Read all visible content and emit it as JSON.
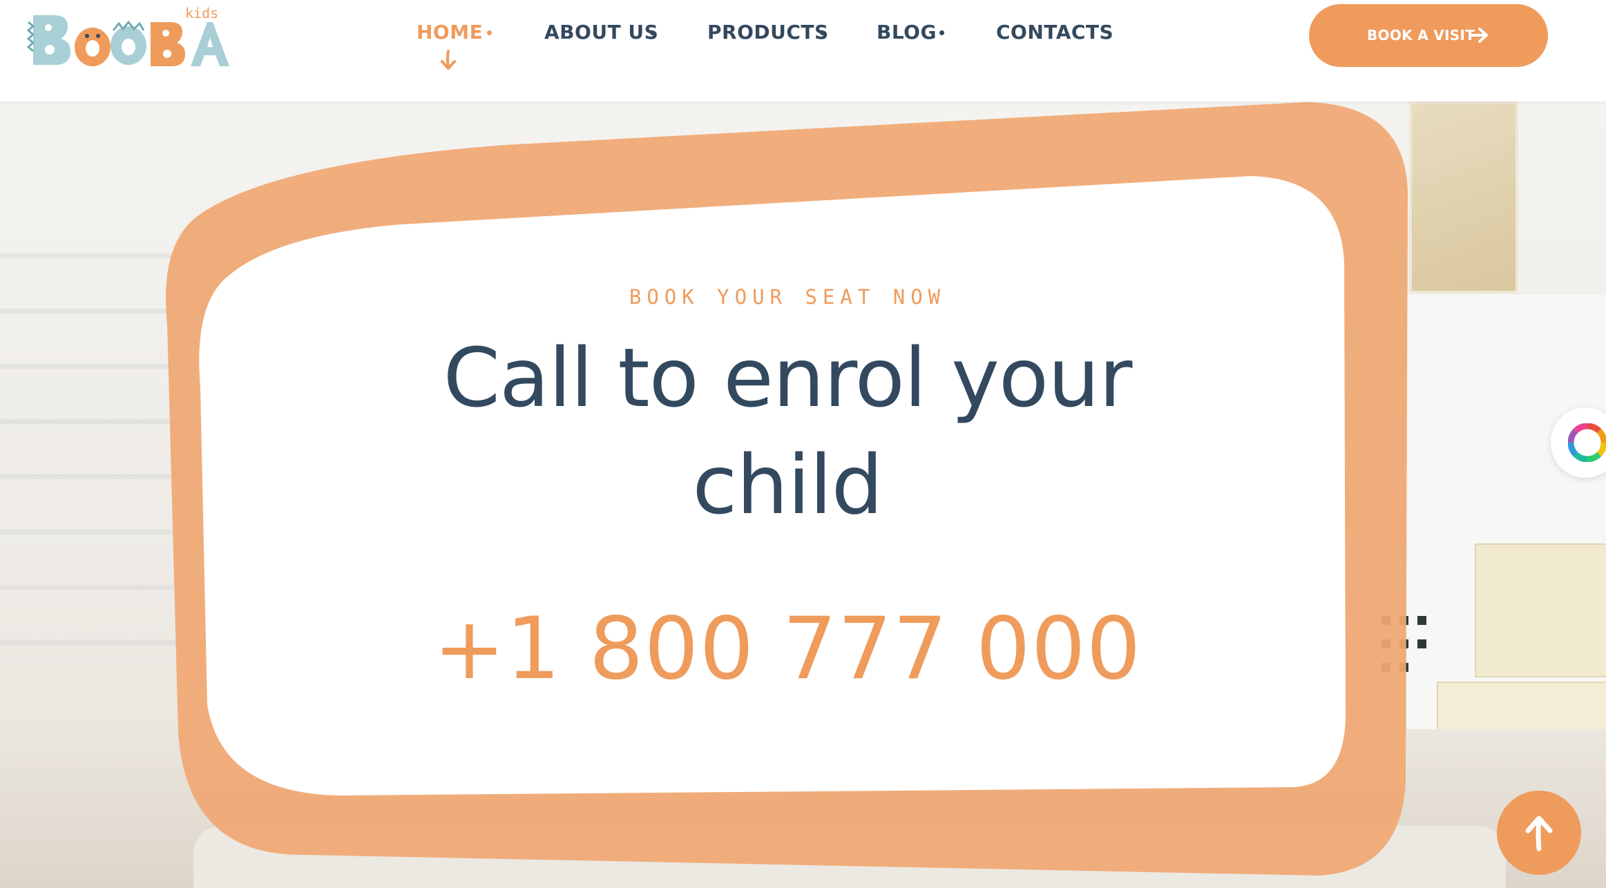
{
  "logo": {
    "word": "BOOBA",
    "tagline": "kids"
  },
  "nav": {
    "items": [
      {
        "label": "HOME",
        "active": true,
        "has_dropdown": true
      },
      {
        "label": "ABOUT US",
        "active": false,
        "has_dropdown": true
      },
      {
        "label": "PRODUCTS",
        "active": false,
        "has_dropdown": true
      },
      {
        "label": "BLOG",
        "active": false,
        "has_dropdown": true
      },
      {
        "label": "CONTACTS",
        "active": false,
        "has_dropdown": false
      }
    ]
  },
  "header": {
    "cta_label": "BOOK A VISIT",
    "cta_icon": "arrow-right-icon"
  },
  "hero": {
    "eyebrow": "BOOK YOUR SEAT NOW",
    "headline_line1": "Call to enrol your",
    "headline_line2": "child",
    "phone": "+1 800 777 000"
  },
  "widgets": {
    "color_switcher_icon": "color-wheel-icon",
    "scroll_top_icon": "arrow-up-icon"
  },
  "colors": {
    "accent": "#ef9b5c",
    "heading": "#33495f",
    "frame": "#f0a873",
    "card": "#ffffff"
  }
}
